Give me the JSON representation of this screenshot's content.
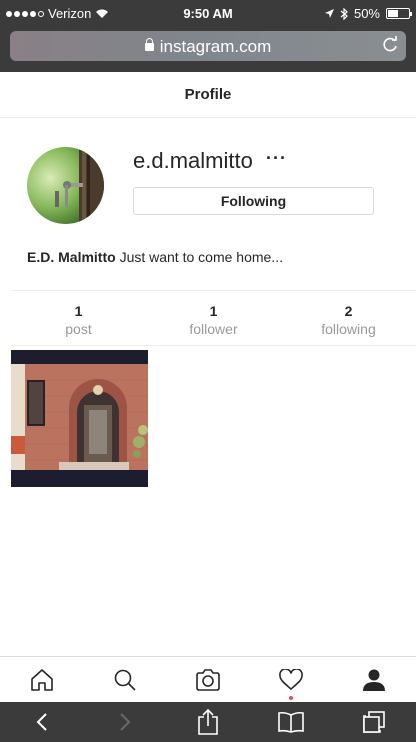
{
  "status_bar": {
    "carrier": "Verizon",
    "time": "9:50 AM",
    "battery": "50%",
    "battery_level": 0.5,
    "signal_icons": [
      "signal-dots-icon",
      "wifi-icon"
    ],
    "right_icons": [
      "location-arrow-icon",
      "bluetooth-icon",
      "battery-icon"
    ]
  },
  "browser": {
    "url": "instagram.com",
    "url_icons": [
      "lock-icon",
      "reload-icon"
    ]
  },
  "header": {
    "title": "Profile"
  },
  "profile": {
    "username": "e.d.malmitto",
    "more_label": "···",
    "follow_button": "Following",
    "bio_name": "E.D. Malmitto",
    "bio_text": "Just want to come home..."
  },
  "stats": [
    {
      "value": "1",
      "label": "post"
    },
    {
      "value": "1",
      "label": "follower"
    },
    {
      "value": "2",
      "label": "following"
    }
  ],
  "bottom_nav": {
    "icons": [
      "home-icon",
      "search-icon",
      "camera-icon",
      "heart-icon",
      "profile-icon"
    ],
    "notification_color": "#ed4956"
  },
  "safari_toolbar": {
    "icons": [
      "back-icon",
      "forward-icon",
      "share-icon",
      "bookmarks-icon",
      "tabs-icon"
    ]
  },
  "colors": {
    "topbar": "#3b3b3b",
    "text": "#262626",
    "muted": "#999999",
    "border": "#dbdbdb"
  }
}
